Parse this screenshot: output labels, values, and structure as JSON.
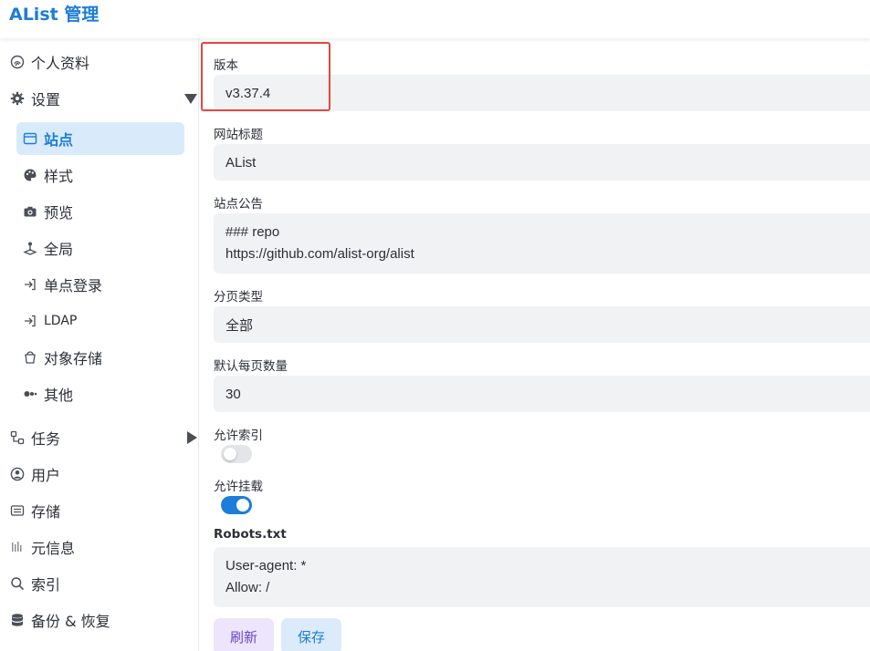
{
  "app": {
    "title": "AList 管理"
  },
  "sidebar": {
    "items": [
      {
        "label": "个人资料",
        "icon": "fingerprint-icon"
      },
      {
        "label": "设置",
        "icon": "gear-icon"
      },
      {
        "label": "站点",
        "icon": "browser-window-icon"
      },
      {
        "label": "样式",
        "icon": "palette-icon"
      },
      {
        "label": "预览",
        "icon": "camera-icon"
      },
      {
        "label": "全局",
        "icon": "joystick-icon"
      },
      {
        "label": "单点登录",
        "icon": "login-arrow-icon"
      },
      {
        "label": "LDAP",
        "icon": "login-arrow-icon"
      },
      {
        "label": "对象存储",
        "icon": "bucket-icon"
      },
      {
        "label": "其他",
        "icon": "dots-icon"
      },
      {
        "label": "任务",
        "icon": "workflow-icon"
      },
      {
        "label": "用户",
        "icon": "user-circle-icon"
      },
      {
        "label": "存储",
        "icon": "storage-icon"
      },
      {
        "label": "元信息",
        "icon": "metadata-icon"
      },
      {
        "label": "索引",
        "icon": "search-icon"
      },
      {
        "label": "备份 & 恢复",
        "icon": "database-icon"
      }
    ]
  },
  "form": {
    "version": {
      "label": "版本",
      "value": "v3.37.4"
    },
    "site_title": {
      "label": "网站标题",
      "value": "AList"
    },
    "announcement": {
      "label": "站点公告",
      "lines": [
        "### repo",
        "https://github.com/alist-org/alist"
      ]
    },
    "pagination_type": {
      "label": "分页类型",
      "value": "全部"
    },
    "default_page_size": {
      "label": "默认每页数量",
      "value": "30"
    },
    "allow_indexed": {
      "label": "允许索引",
      "enabled": false
    },
    "allow_mounted": {
      "label": "允许挂载",
      "enabled": true
    },
    "robots": {
      "label": "Robots.txt",
      "lines": [
        "User-agent: *",
        "Allow: /"
      ]
    }
  },
  "buttons": {
    "refresh": "刷新",
    "save": "保存"
  },
  "colors": {
    "accent": "#1d7dd8",
    "highlight_border": "#e0483f"
  }
}
